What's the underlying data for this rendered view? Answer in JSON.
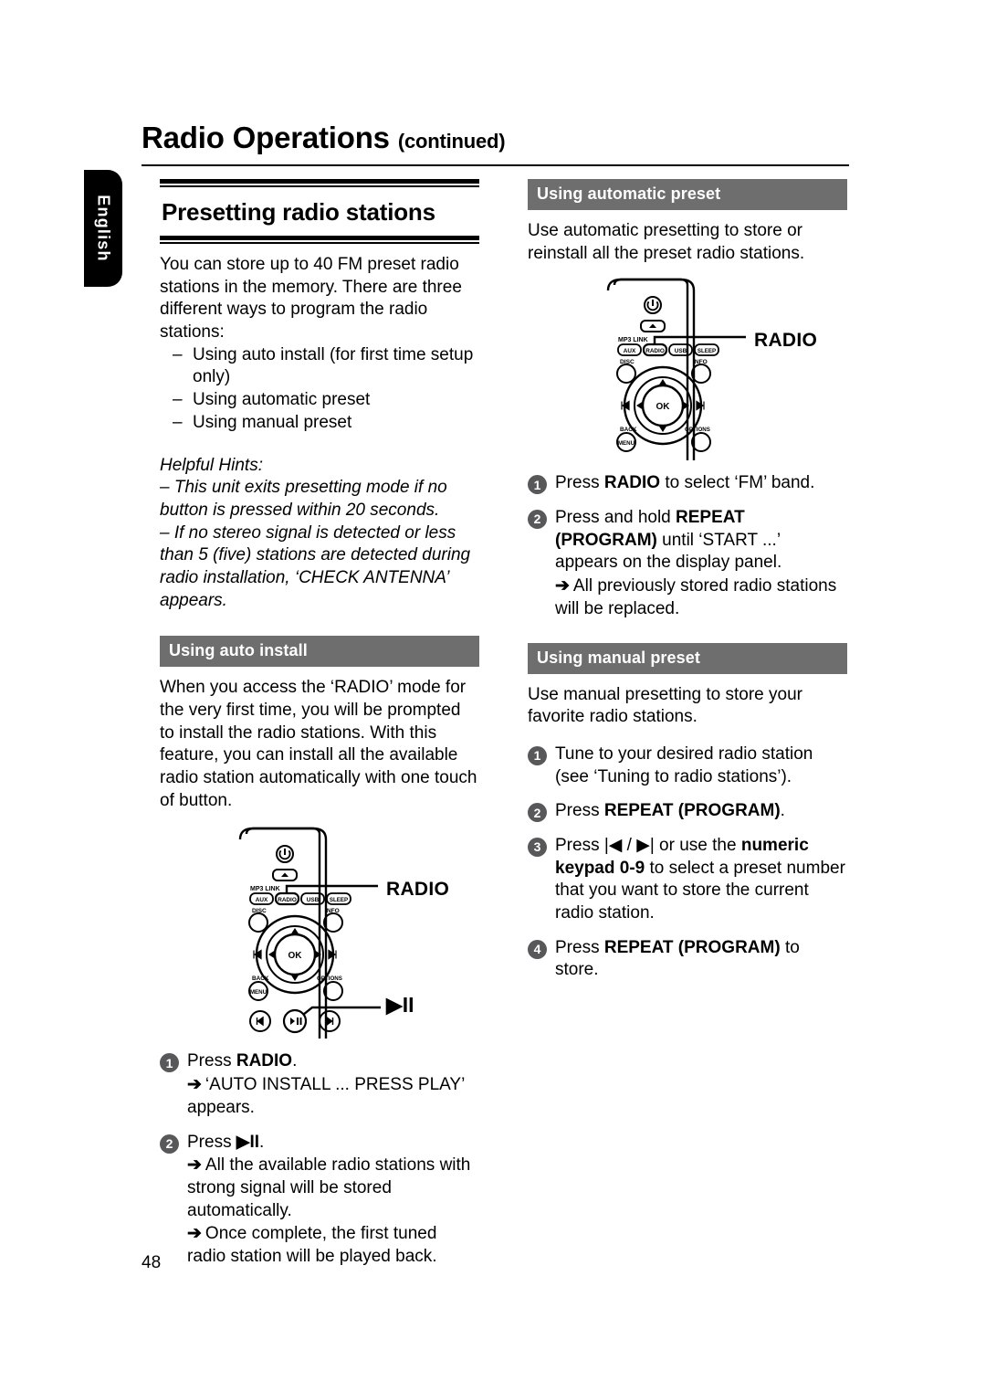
{
  "header": {
    "title": "Radio Operations",
    "continued": "(continued)"
  },
  "lang_tab": {
    "label": "English"
  },
  "page_number": "48",
  "colors": {
    "bar_gray": "#6e6e6e",
    "step_badge": "#58585a",
    "rule_black": "#000000"
  },
  "left_column": {
    "section_title": "Presetting radio stations",
    "intro": "You can store up to 40 FM preset radio stations in the memory. There are three different ways to program the radio stations:",
    "ways": [
      "Using auto install (for first time setup only)",
      "Using automatic preset",
      "Using manual preset"
    ],
    "hints": {
      "heading": "Helpful Hints:",
      "lines": [
        "– This unit exits presetting mode if no button is pressed within 20 seconds.",
        "– If no stereo signal is detected or less than 5 (five) stations are detected during radio installation, ‘CHECK ANTENNA’ appears."
      ]
    },
    "auto_install": {
      "bar": "Using auto install",
      "body": "When you access the ‘RADIO’ mode for the very first time, you will be prompted to install the radio stations. With this feature, you can install all the available radio station automatically with one touch of button.",
      "steps": [
        {
          "num": "1",
          "text_pre": "Press ",
          "text_bold": "RADIO",
          "text_post": ".",
          "subs": [
            "‘AUTO INSTALL ... PRESS PLAY’ appears."
          ]
        },
        {
          "num": "2",
          "text_pre": "Press ",
          "text_bold": "▶II",
          "text_post": ".",
          "subs": [
            "All the available radio stations with strong signal will be stored automatically.",
            "Once complete, the first tuned radio station will be played back."
          ]
        }
      ]
    }
  },
  "right_column": {
    "automatic_preset": {
      "bar": "Using automatic preset",
      "body": "Use automatic presetting to store or reinstall all the preset radio stations.",
      "steps": [
        {
          "num": "1",
          "text_pre": "Press ",
          "text_bold": "RADIO",
          "text_post": " to select ‘FM’ band.",
          "subs": []
        },
        {
          "num": "2",
          "text_pre": "Press and hold ",
          "text_bold": "REPEAT (PROGRAM)",
          "text_post": " until ‘START ...’ appears on the display panel.",
          "subs": [
            "All previously stored radio stations will be replaced."
          ]
        }
      ]
    },
    "manual_preset": {
      "bar": "Using manual preset",
      "body": "Use manual presetting to store your favorite radio stations.",
      "steps": [
        {
          "num": "1",
          "text_pre": "Tune to your desired radio station (see ‘Tuning to radio stations’).",
          "text_bold": "",
          "text_post": "",
          "subs": []
        },
        {
          "num": "2",
          "text_pre": "Press ",
          "text_bold": "REPEAT (PROGRAM)",
          "text_post": ".",
          "subs": []
        },
        {
          "num": "3",
          "text_pre": "Press |◀ / ▶| or use the ",
          "text_bold": "numeric keypad 0-9",
          "text_post": " to select a preset number that you want to store the current radio station.",
          "subs": []
        },
        {
          "num": "4",
          "text_pre": "Press ",
          "text_bold": "REPEAT (PROGRAM)",
          "text_post": " to store.",
          "subs": []
        }
      ]
    }
  },
  "remote_left": {
    "callout_radio": "RADIO",
    "callout_play": "▶II",
    "buttons": {
      "power": "power-standby",
      "eject": "eject",
      "mp3_link": "MP3 LINK",
      "aux": "AUX",
      "radio": "RADIO",
      "usb": "USB",
      "sleep": "SLEEP",
      "disc": "DISC",
      "info": "INFO",
      "ok": "OK",
      "back_menu": "MENU",
      "back_label": "BACK",
      "options": "OPTIONS",
      "prev": "|◀",
      "play_pause": "▶II",
      "next": "▶|"
    }
  },
  "remote_right": {
    "callout_radio": "RADIO",
    "buttons": {
      "power": "power-standby",
      "eject": "eject",
      "mp3_link": "MP3 LINK",
      "aux": "AUX",
      "radio": "RADIO",
      "usb": "USB",
      "sleep": "SLEEP",
      "disc": "DISC",
      "info": "INFO",
      "ok": "OK",
      "back_menu": "MENU",
      "back_label": "BACK",
      "options": "OPTIONS"
    }
  }
}
